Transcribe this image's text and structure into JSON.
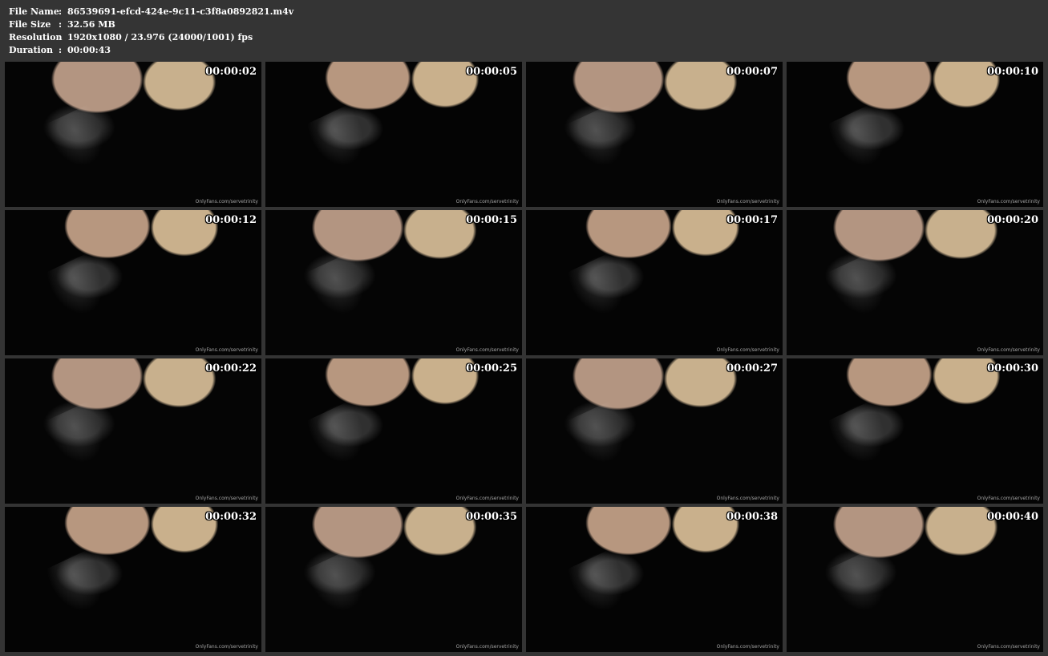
{
  "info": {
    "rows": [
      {
        "label": "File Name",
        "sep": ":",
        "value": "86539691-efcd-424e-9c11-c3f8a0892821.m4v"
      },
      {
        "label": "File Size",
        "sep": ":",
        "value": "32.56 MB"
      },
      {
        "label": "Resolution",
        "sep": ":",
        "value": "1920x1080 / 23.976 (24000/1001) fps"
      },
      {
        "label": "Duration",
        "sep": ":",
        "value": "00:00:43"
      }
    ]
  },
  "thumbnails": [
    {
      "time": "00:00:02",
      "watermark": "OnlyFans.com/servetrinity"
    },
    {
      "time": "00:00:05",
      "watermark": "OnlyFans.com/servetrinity"
    },
    {
      "time": "00:00:07",
      "watermark": "OnlyFans.com/servetrinity"
    },
    {
      "time": "00:00:10",
      "watermark": "OnlyFans.com/servetrinity"
    },
    {
      "time": "00:00:12",
      "watermark": "OnlyFans.com/servetrinity"
    },
    {
      "time": "00:00:15",
      "watermark": "OnlyFans.com/servetrinity"
    },
    {
      "time": "00:00:17",
      "watermark": "OnlyFans.com/servetrinity"
    },
    {
      "time": "00:00:20",
      "watermark": "OnlyFans.com/servetrinity"
    },
    {
      "time": "00:00:22",
      "watermark": "OnlyFans.com/servetrinity"
    },
    {
      "time": "00:00:25",
      "watermark": "OnlyFans.com/servetrinity"
    },
    {
      "time": "00:00:27",
      "watermark": "OnlyFans.com/servetrinity"
    },
    {
      "time": "00:00:30",
      "watermark": "OnlyFans.com/servetrinity"
    },
    {
      "time": "00:00:32",
      "watermark": "OnlyFans.com/servetrinity"
    },
    {
      "time": "00:00:35",
      "watermark": "OnlyFans.com/servetrinity"
    },
    {
      "time": "00:00:38",
      "watermark": "OnlyFans.com/servetrinity"
    },
    {
      "time": "00:00:40",
      "watermark": "OnlyFans.com/servetrinity"
    }
  ]
}
